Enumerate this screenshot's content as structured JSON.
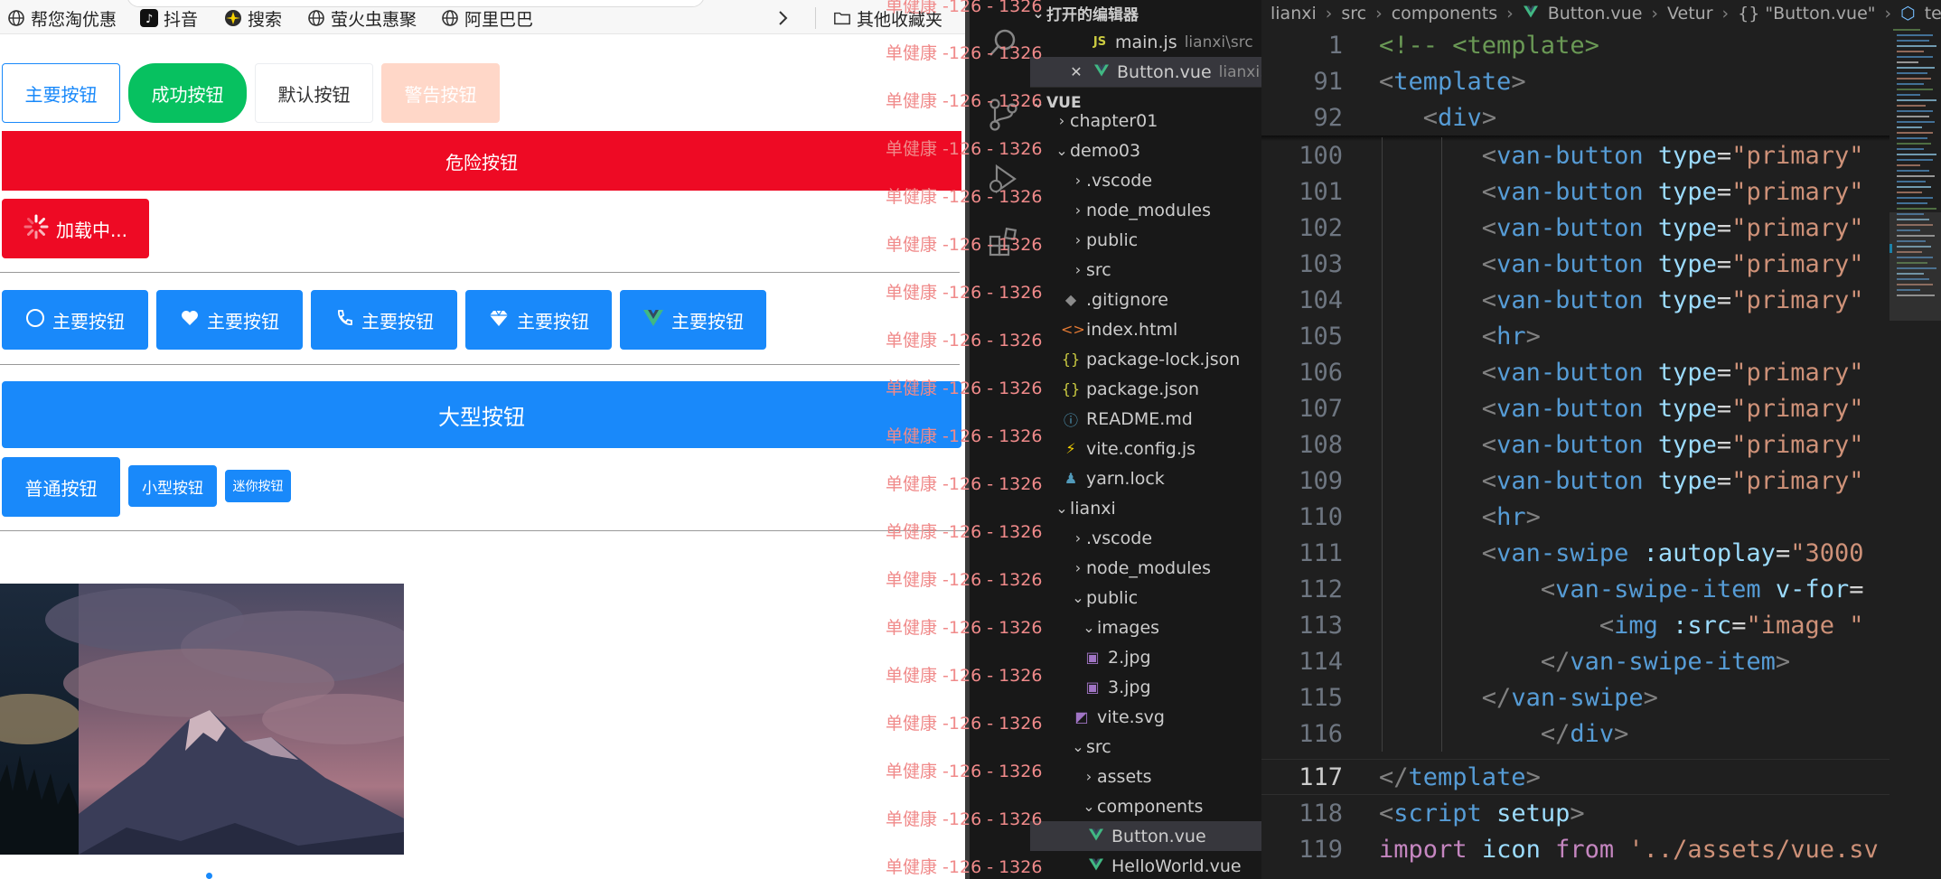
{
  "bookmarks": {
    "items": [
      "帮您淘优惠",
      "抖音",
      "搜索",
      "萤火虫惠聚",
      "阿里巴巴"
    ],
    "more_label": "其他收藏夹"
  },
  "vant": {
    "row1": {
      "primary": "主要按钮",
      "success": "成功按钮",
      "default": "默认按钮",
      "warning": "警告按钮"
    },
    "danger": "危险按钮",
    "loading": "加载中...",
    "icon_buttons": [
      "主要按钮",
      "主要按钮",
      "主要按钮",
      "主要按钮",
      "主要按钮"
    ],
    "large": "大型按钮",
    "normal": "普通按钮",
    "small": "小型按钮",
    "mini": "迷你按钮",
    "colors": {
      "primary": "#1989fa",
      "success": "#07c160",
      "danger": "#ee0a24",
      "warning_disabled": "#ffd7c8"
    }
  },
  "watermark": "单健康 -126 - 1326",
  "explorer": {
    "open_editors_label": "打开的编辑器",
    "open_editors": [
      {
        "name": "main.js",
        "path": "lianxi\\src"
      },
      {
        "name": "Button.vue",
        "path": "lianxi..."
      }
    ],
    "workspace_label": "VUE",
    "tree": [
      "chapter01",
      "demo03",
      ".vscode",
      "node_modules",
      "public",
      "src",
      ".gitignore",
      "index.html",
      "package-lock.json",
      "package.json",
      "README.md",
      "vite.config.js",
      "yarn.lock",
      "lianxi",
      ".vscode",
      "node_modules",
      "public",
      "images",
      "2.jpg",
      "3.jpg",
      "vite.svg",
      "src",
      "assets",
      "components",
      "Button.vue",
      "HelloWorld.vue"
    ]
  },
  "editor": {
    "breadcrumb": [
      "lianxi",
      "src",
      "components",
      "Button.vue",
      "Vetur",
      "{} \"Button.vue\"",
      "template"
    ],
    "line_numbers": [
      "1",
      "91",
      "92",
      "100",
      "101",
      "102",
      "103",
      "104",
      "105",
      "106",
      "107",
      "108",
      "109",
      "110",
      "111",
      "112",
      "113",
      "114",
      "115",
      "116",
      "117",
      "118",
      "119"
    ]
  }
}
